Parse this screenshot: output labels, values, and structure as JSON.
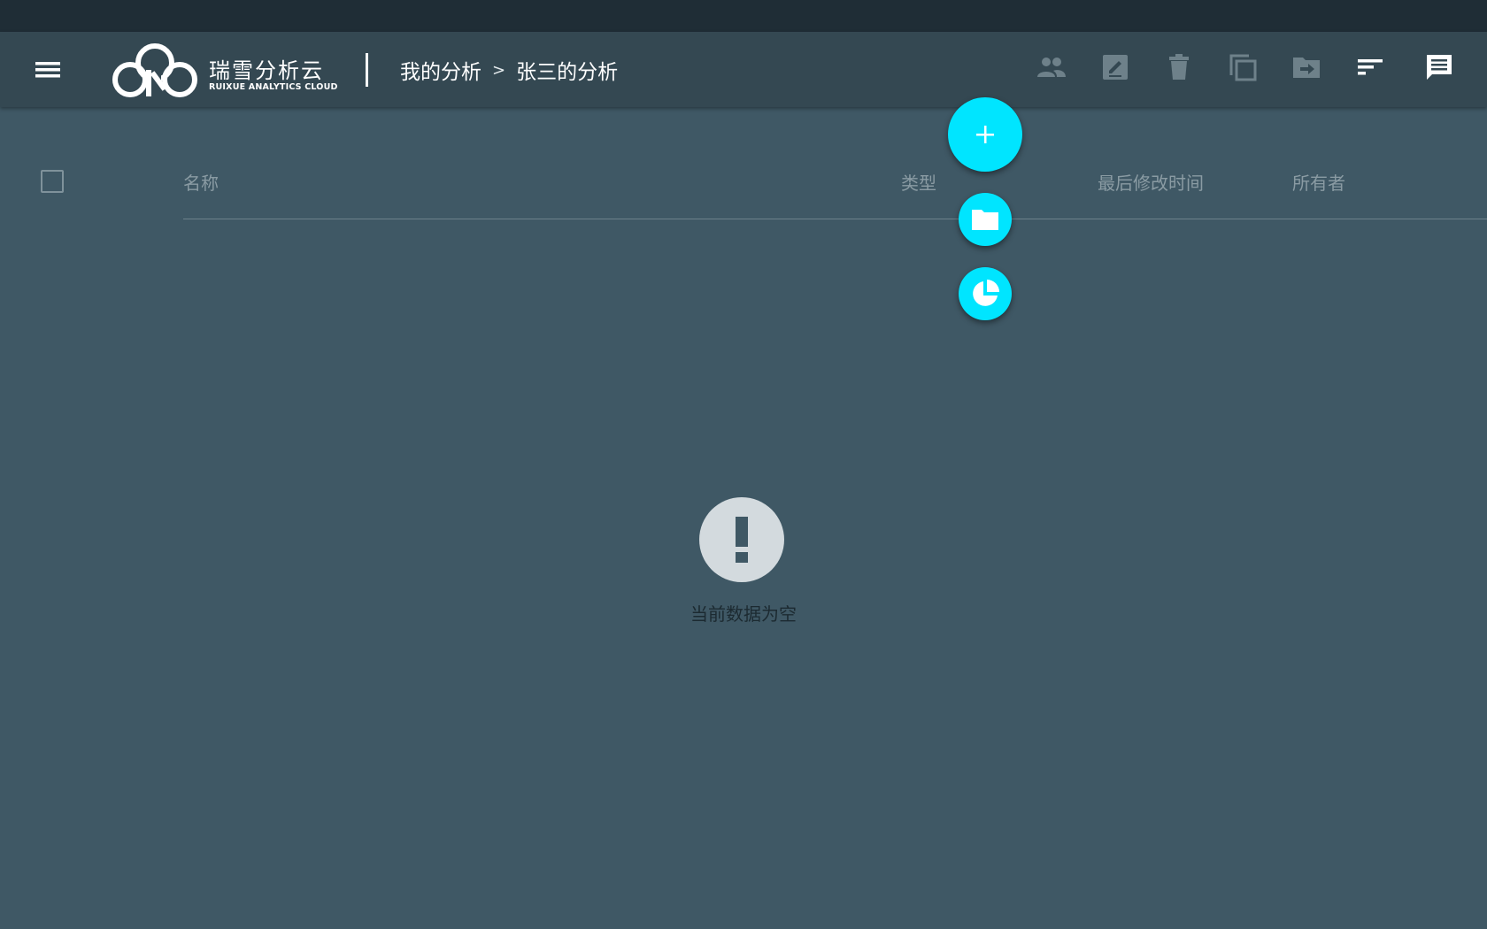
{
  "app": {
    "brand_name": "瑞雪分析云",
    "brand_subtitle": "RUIXUE ANALYTICS CLOUD"
  },
  "header": {
    "breadcrumb": [
      "我的分析",
      "张三的分析"
    ],
    "breadcrumb_separator": ">",
    "toolbar_icons": [
      "share-users-icon",
      "edit-icon",
      "delete-icon",
      "copy-icon",
      "move-to-folder-icon",
      "sort-icon",
      "comment-icon"
    ]
  },
  "table": {
    "columns": [
      "名称",
      "类型",
      "最后修改时间",
      "所有者"
    ]
  },
  "fab": {
    "main_symbol": "+",
    "actions": [
      "folder-icon",
      "pie-chart-icon"
    ]
  },
  "empty_state": {
    "icon_symbol": "!",
    "message": "当前数据为空"
  },
  "colors": {
    "accent": "#00e5ff",
    "background": "#3f5865",
    "header": "#344852",
    "topbar": "#1f2d36"
  }
}
